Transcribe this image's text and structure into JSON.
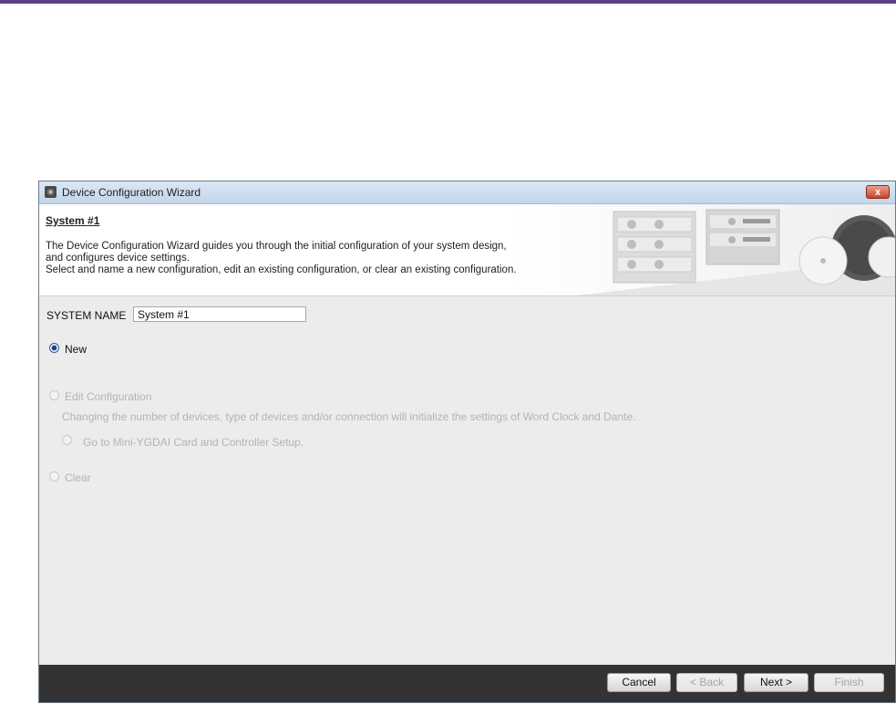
{
  "window": {
    "title": "Device Configuration Wizard",
    "close_glyph": "x"
  },
  "banner": {
    "heading": "System #1",
    "description": [
      "The Device Configuration Wizard guides you through the initial configuration of your system design,",
      "and configures device settings.",
      "Select and name a new configuration, edit an existing configuration, or clear an existing configuration."
    ]
  },
  "system_name": {
    "label": "SYSTEM NAME",
    "value": "System #1"
  },
  "options": {
    "new": {
      "label": "New",
      "selected": true,
      "enabled": true
    },
    "edit": {
      "label": "Edit Configuration",
      "note": "Changing the number of devices, type of devices and/or connection will initialize the settings of Word Clock and Dante.",
      "enabled": false
    },
    "goto": {
      "label": "Go to Mini-YGDAI Card and Controller Setup.",
      "enabled": false
    },
    "clear": {
      "label": "Clear",
      "enabled": false
    }
  },
  "buttons": {
    "cancel": "Cancel",
    "back": "< Back",
    "next": "Next >",
    "finish": "Finish"
  },
  "colors": {
    "accent_rule": "#5b3f86",
    "footer": "#333333",
    "disabled_text": "#b3b3b3"
  }
}
